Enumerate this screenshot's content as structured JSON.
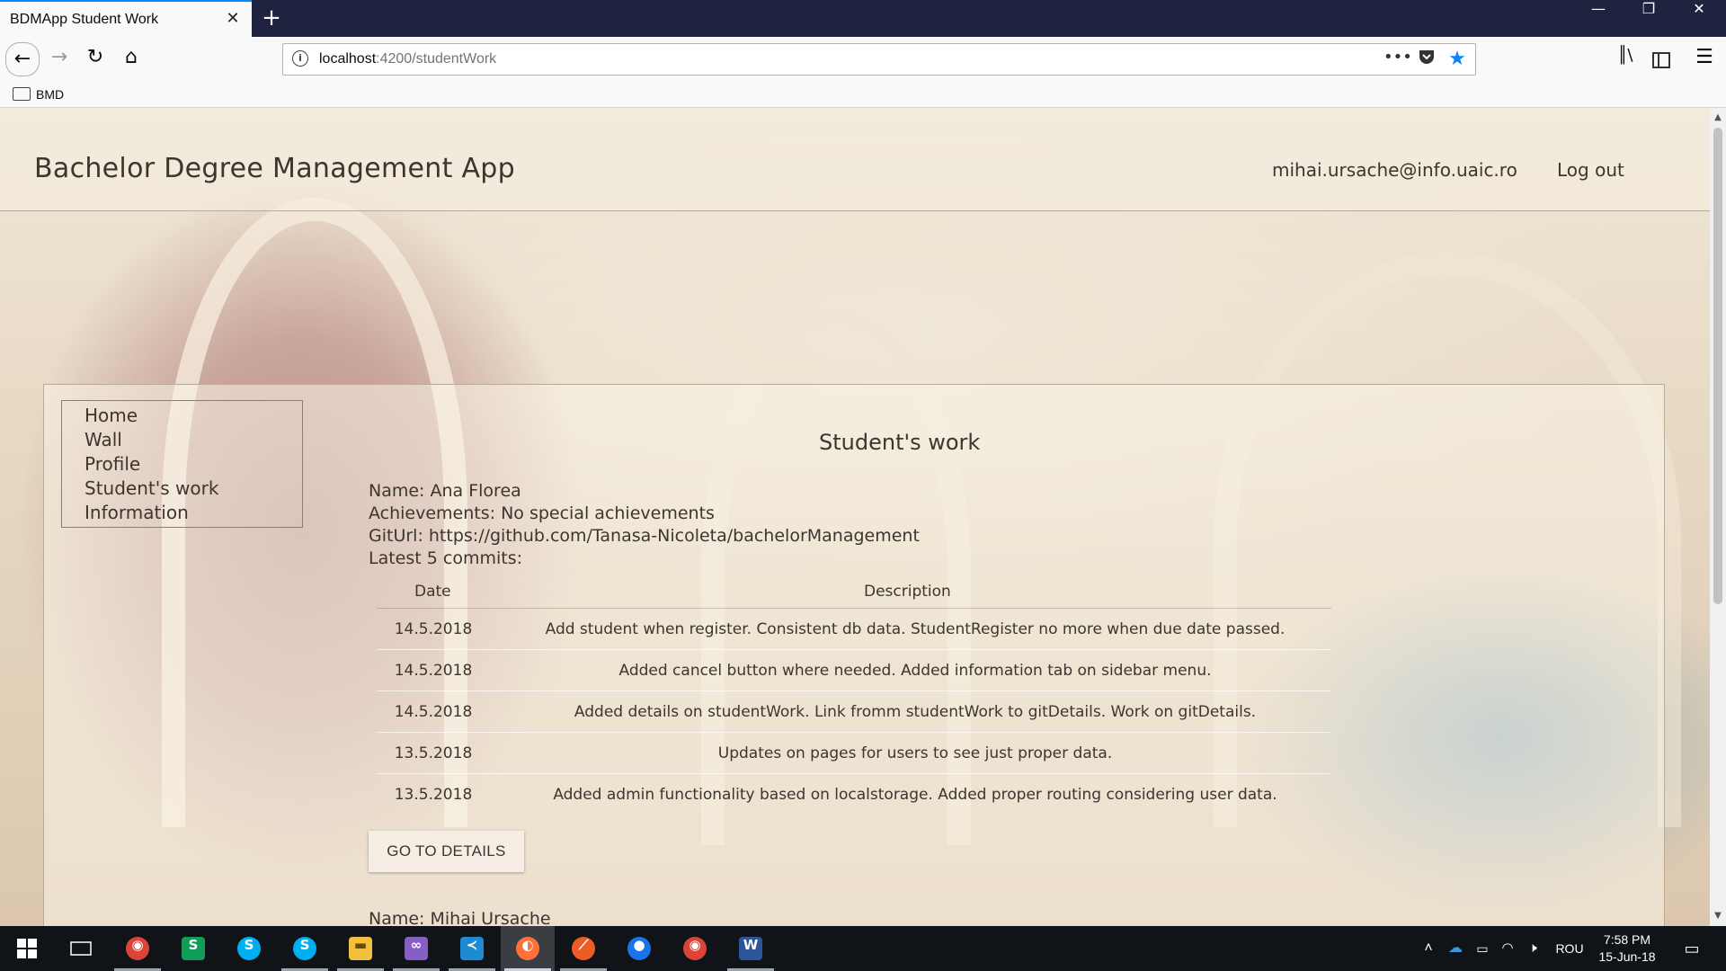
{
  "browser": {
    "tab_title": "BDMApp Student Work",
    "tab_close": "✕",
    "new_tab": "+",
    "url_host": "localhost",
    "url_rest": ":4200/studentWork",
    "bookmark": "BMD",
    "window": {
      "minimize": "—",
      "restore": "❐",
      "close": "✕"
    }
  },
  "app": {
    "title": "Bachelor Degree Management App",
    "user_email": "mihai.ursache@info.uaic.ro",
    "logout": "Log out"
  },
  "sidebar": {
    "items": [
      {
        "label": "Home"
      },
      {
        "label": "Wall"
      },
      {
        "label": "Profile"
      },
      {
        "label": "Student's work"
      },
      {
        "label": "Information"
      }
    ]
  },
  "main": {
    "title": "Student's work",
    "student": {
      "name_line": "Name: Ana Florea",
      "achievements_line": "Achievements: No special achievements",
      "giturl_line": "GitUrl: https://github.com/Tanasa-Nicoleta/bachelorManagement",
      "commits_label": "Latest 5 commits:"
    },
    "table": {
      "headers": {
        "date": "Date",
        "description": "Description"
      },
      "rows": [
        {
          "date": "14.5.2018",
          "description": "Add student when register. Consistent db data. StudentRegister no more when due date passed."
        },
        {
          "date": "14.5.2018",
          "description": "Added cancel button where needed. Added information tab on sidebar menu."
        },
        {
          "date": "14.5.2018",
          "description": "Added details on studentWork. Link fromm studentWork to gitDetails. Work on gitDetails."
        },
        {
          "date": "13.5.2018",
          "description": "Updates on pages for users to see just proper data."
        },
        {
          "date": "13.5.2018",
          "description": "Added admin functionality based on localstorage. Added proper routing considering user data."
        }
      ]
    },
    "details_button": "GO TO DETAILS",
    "next_student_name": "Name: Mihai Ursache"
  },
  "taskbar": {
    "apps": [
      {
        "name": "chrome",
        "glyph": "◉",
        "color": "#db4437"
      },
      {
        "name": "sheets",
        "glyph": "S",
        "color": "#0f9d58"
      },
      {
        "name": "skype",
        "glyph": "S",
        "color": "#00aff0"
      },
      {
        "name": "skype-2",
        "glyph": "S",
        "color": "#00aff0"
      },
      {
        "name": "explorer",
        "glyph": "▬",
        "color": "#f3c03c"
      },
      {
        "name": "visual-studio",
        "glyph": "∞",
        "color": "#865fc5"
      },
      {
        "name": "vscode",
        "glyph": "≺",
        "color": "#1f8ad2"
      },
      {
        "name": "firefox",
        "glyph": "◐",
        "color": "#ff7139"
      },
      {
        "name": "postman",
        "glyph": "⟋",
        "color": "#ef5b25"
      },
      {
        "name": "maps",
        "glyph": "●",
        "color": "#1a73e8"
      },
      {
        "name": "chrome-2",
        "glyph": "◉",
        "color": "#db4437"
      },
      {
        "name": "word",
        "glyph": "W",
        "color": "#2b579a"
      }
    ],
    "language": "ROU",
    "time": "7:58 PM",
    "date": "15-Jun-18"
  }
}
